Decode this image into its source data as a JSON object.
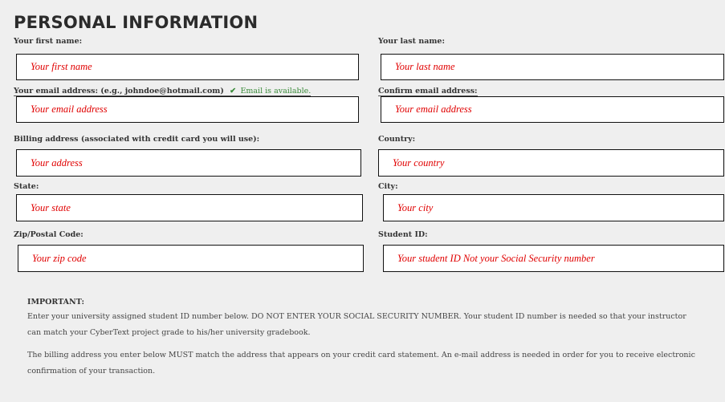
{
  "form": {
    "title": "PERSONAL INFORMATION",
    "first_name_label": "Your first name:",
    "first_name_placeholder": "Your first name",
    "last_name_label": "Your last name:",
    "last_name_placeholder": "Your last name",
    "email_label": "Your email address: (e.g., johndoe@hotmail.com)",
    "email_status": "Email is available.",
    "email_placeholder": "Your email address",
    "confirm_email_label": "Confirm email address:",
    "confirm_email_placeholder": "Your email address",
    "billing_label": "Billing address (associated with credit card you will use):",
    "billing_placeholder": "Your address",
    "country_label": "Country:",
    "country_placeholder": "Your country",
    "state_label": "State:",
    "state_placeholder": "Your state",
    "city_label": "City:",
    "city_placeholder": "Your city",
    "zip_label": "Zip/Postal Code:",
    "zip_placeholder": "Your zip code",
    "student_id_label": "Student ID:",
    "student_id_placeholder": "Your student ID  Not your Social Security number"
  },
  "notice": {
    "heading": "IMPORTANT:",
    "paragraph1": "Enter your university assigned student ID number below. DO NOT ENTER YOUR SOCIAL SECURITY NUMBER. Your student ID number is needed so that your instructor can match your CyberText project grade to his/her university gradebook.",
    "paragraph2": "The billing address you enter below MUST match the address that appears on your credit card statement. An e-mail address is needed in order for you to receive electronic confirmation of your transaction."
  },
  "icons": {
    "email_status_icon": "checkmark-icon"
  },
  "colors": {
    "placeholder": "#e00000",
    "status_ok": "#3a8a3a"
  }
}
